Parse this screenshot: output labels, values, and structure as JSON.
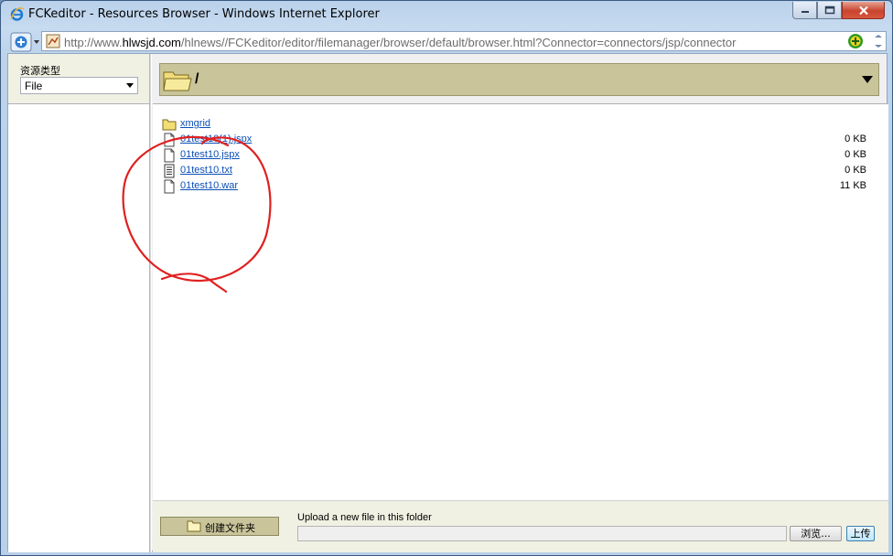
{
  "window": {
    "title": "FCKeditor - Resources Browser - Windows Internet Explorer",
    "address_prefix": "http://www.",
    "address_domain": "hlwsjd.com",
    "address_rest": "/hlnews//FCKeditor/editor/filemanager/browser/default/browser.html?Connector=connectors/jsp/connector"
  },
  "sidebar": {
    "type_label": "资源类型",
    "type_value": "File"
  },
  "folder_bar": {
    "path": "/"
  },
  "files": [
    {
      "name": "xmgrid",
      "size": "",
      "kind": "folder-icon"
    },
    {
      "name": "01test10(1).jspx",
      "size": "0 KB",
      "kind": "file-icon"
    },
    {
      "name": "01test10.jspx",
      "size": "0 KB",
      "kind": "file-icon"
    },
    {
      "name": "01test10.txt",
      "size": "0 KB",
      "kind": "text-file-icon"
    },
    {
      "name": "01test10.war",
      "size": "11 KB",
      "kind": "file-icon"
    }
  ],
  "bottom": {
    "create_folder_label": "创建文件夹",
    "upload_label": "Upload a new file in this folder",
    "browse_label": "浏览...",
    "upload_button_label": "上传"
  },
  "colors": {
    "folder_bar": "#c9c49a",
    "link": "#0b4fb6",
    "annotation": "#e02020"
  }
}
